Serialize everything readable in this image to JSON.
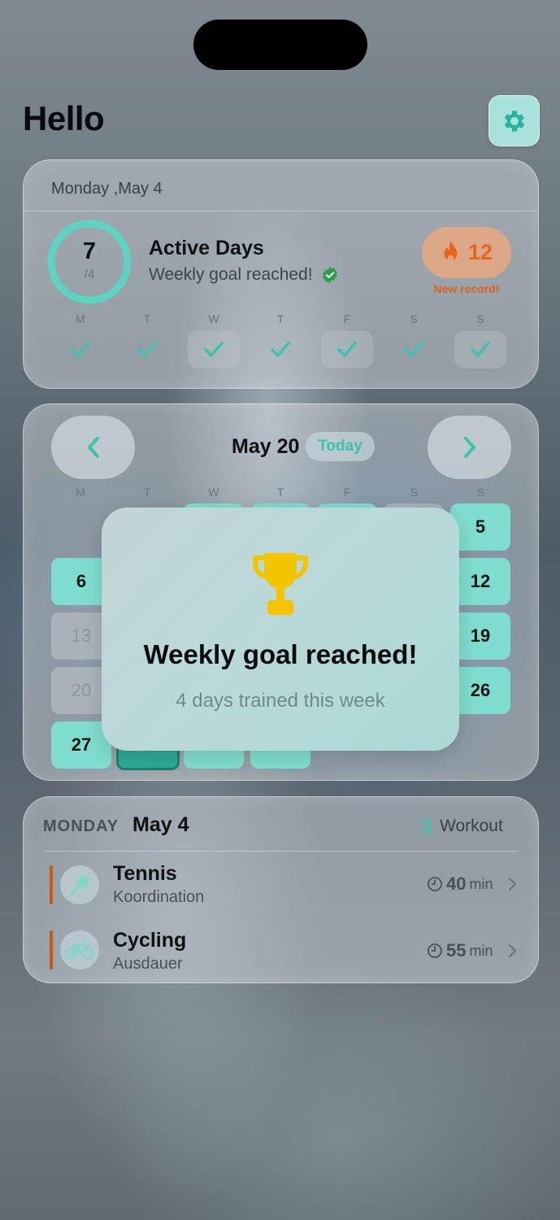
{
  "greeting": "Hello",
  "summary": {
    "date": "Monday ,May 4",
    "active_days": "7",
    "goal": "/4",
    "title": "Active Days",
    "subtitle": "Weekly goal reached!",
    "streak": "12",
    "streak_note": "New record!",
    "weekdays": [
      "M",
      "T",
      "W",
      "T",
      "F",
      "S",
      "S"
    ],
    "week_progress": [
      true,
      true,
      true,
      true,
      true,
      true,
      true
    ]
  },
  "calendar": {
    "month": "May 20",
    "today_label": "Today",
    "weekdays": [
      "M",
      "T",
      "W",
      "T",
      "F",
      "S",
      "S"
    ],
    "days": [
      "5",
      "6",
      "12",
      "13",
      "19",
      "20",
      "26",
      "27"
    ]
  },
  "popup": {
    "title": "Weekly goal reached!",
    "subtitle": "4 days trained this week"
  },
  "day_detail": {
    "weekday": "MONDAY",
    "date": "May 4",
    "count": "1",
    "count_label": "Workout",
    "workouts": [
      {
        "name": "Tennis",
        "category": "Koordination",
        "duration": "40",
        "unit": "min",
        "icon": "tennis-racket-icon"
      },
      {
        "name": "Cycling",
        "category": "Ausdauer",
        "duration": "55",
        "unit": "min",
        "icon": "bicycle-icon"
      }
    ]
  },
  "colors": {
    "accent": "#3ec2b0",
    "streak": "#e8651e",
    "day_fill": "#7fddcf",
    "bar": "#c45a14"
  }
}
